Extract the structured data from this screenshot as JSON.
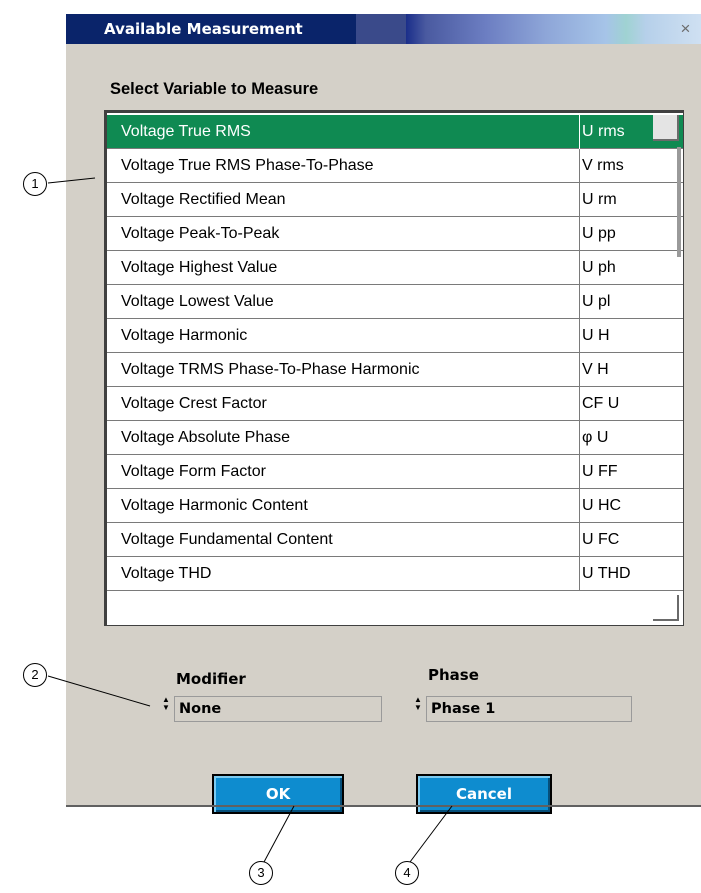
{
  "window": {
    "title": "Available Measurement",
    "close_glyph": "×"
  },
  "list": {
    "heading": "Select Variable to Measure",
    "selected_index": 0,
    "items": [
      {
        "name": "Voltage True RMS",
        "symbol": "U rms"
      },
      {
        "name": "Voltage True RMS Phase-To-Phase",
        "symbol": "V rms"
      },
      {
        "name": "Voltage Rectified Mean",
        "symbol": "U rm"
      },
      {
        "name": "Voltage Peak-To-Peak",
        "symbol": "U pp"
      },
      {
        "name": "Voltage Highest Value",
        "symbol": "U ph"
      },
      {
        "name": "Voltage Lowest Value",
        "symbol": "U pl"
      },
      {
        "name": "Voltage Harmonic",
        "symbol": "U H"
      },
      {
        "name": "Voltage TRMS Phase-To-Phase Harmonic",
        "symbol": "V H"
      },
      {
        "name": "Voltage Crest Factor",
        "symbol": "CF U"
      },
      {
        "name": "Voltage Absolute Phase",
        "symbol": "φ U"
      },
      {
        "name": "Voltage Form Factor",
        "symbol": "U FF"
      },
      {
        "name": "Voltage Harmonic Content",
        "symbol": "U HC"
      },
      {
        "name": "Voltage Fundamental Content",
        "symbol": "U FC"
      },
      {
        "name": "Voltage THD",
        "symbol": "U THD"
      }
    ]
  },
  "modifier": {
    "label": "Modifier",
    "value": "None"
  },
  "phase": {
    "label": "Phase",
    "value": "Phase 1"
  },
  "buttons": {
    "ok": "OK",
    "cancel": "Cancel"
  },
  "callouts": [
    "1",
    "2",
    "3",
    "4"
  ],
  "colors": {
    "selected_row": "#0f8a52",
    "button": "#0e8ccf",
    "title_bar": "#0a246a"
  }
}
